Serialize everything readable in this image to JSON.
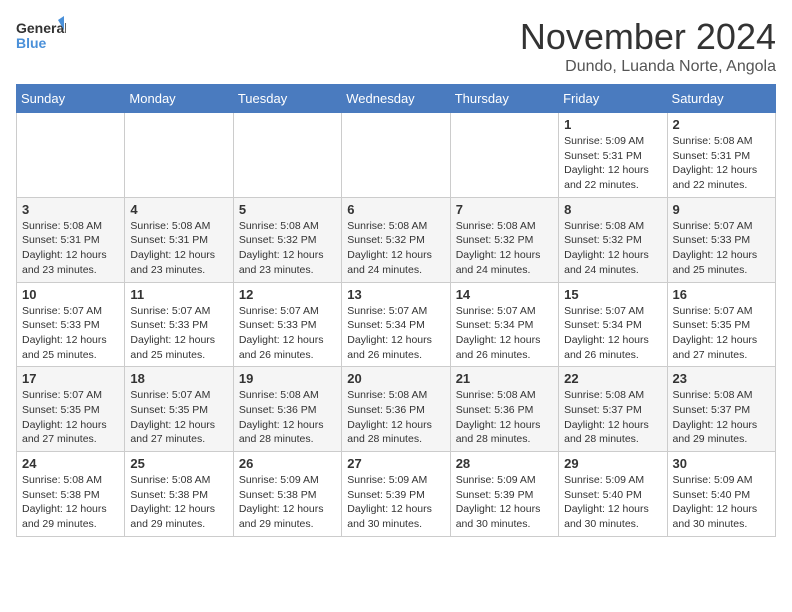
{
  "header": {
    "logo_general": "General",
    "logo_blue": "Blue",
    "month_title": "November 2024",
    "location": "Dundo, Luanda Norte, Angola"
  },
  "calendar": {
    "days_of_week": [
      "Sunday",
      "Monday",
      "Tuesday",
      "Wednesday",
      "Thursday",
      "Friday",
      "Saturday"
    ],
    "weeks": [
      [
        {
          "day": "",
          "info": ""
        },
        {
          "day": "",
          "info": ""
        },
        {
          "day": "",
          "info": ""
        },
        {
          "day": "",
          "info": ""
        },
        {
          "day": "",
          "info": ""
        },
        {
          "day": "1",
          "info": "Sunrise: 5:09 AM\nSunset: 5:31 PM\nDaylight: 12 hours\nand 22 minutes."
        },
        {
          "day": "2",
          "info": "Sunrise: 5:08 AM\nSunset: 5:31 PM\nDaylight: 12 hours\nand 22 minutes."
        }
      ],
      [
        {
          "day": "3",
          "info": "Sunrise: 5:08 AM\nSunset: 5:31 PM\nDaylight: 12 hours\nand 23 minutes."
        },
        {
          "day": "4",
          "info": "Sunrise: 5:08 AM\nSunset: 5:31 PM\nDaylight: 12 hours\nand 23 minutes."
        },
        {
          "day": "5",
          "info": "Sunrise: 5:08 AM\nSunset: 5:32 PM\nDaylight: 12 hours\nand 23 minutes."
        },
        {
          "day": "6",
          "info": "Sunrise: 5:08 AM\nSunset: 5:32 PM\nDaylight: 12 hours\nand 24 minutes."
        },
        {
          "day": "7",
          "info": "Sunrise: 5:08 AM\nSunset: 5:32 PM\nDaylight: 12 hours\nand 24 minutes."
        },
        {
          "day": "8",
          "info": "Sunrise: 5:08 AM\nSunset: 5:32 PM\nDaylight: 12 hours\nand 24 minutes."
        },
        {
          "day": "9",
          "info": "Sunrise: 5:07 AM\nSunset: 5:33 PM\nDaylight: 12 hours\nand 25 minutes."
        }
      ],
      [
        {
          "day": "10",
          "info": "Sunrise: 5:07 AM\nSunset: 5:33 PM\nDaylight: 12 hours\nand 25 minutes."
        },
        {
          "day": "11",
          "info": "Sunrise: 5:07 AM\nSunset: 5:33 PM\nDaylight: 12 hours\nand 25 minutes."
        },
        {
          "day": "12",
          "info": "Sunrise: 5:07 AM\nSunset: 5:33 PM\nDaylight: 12 hours\nand 26 minutes."
        },
        {
          "day": "13",
          "info": "Sunrise: 5:07 AM\nSunset: 5:34 PM\nDaylight: 12 hours\nand 26 minutes."
        },
        {
          "day": "14",
          "info": "Sunrise: 5:07 AM\nSunset: 5:34 PM\nDaylight: 12 hours\nand 26 minutes."
        },
        {
          "day": "15",
          "info": "Sunrise: 5:07 AM\nSunset: 5:34 PM\nDaylight: 12 hours\nand 26 minutes."
        },
        {
          "day": "16",
          "info": "Sunrise: 5:07 AM\nSunset: 5:35 PM\nDaylight: 12 hours\nand 27 minutes."
        }
      ],
      [
        {
          "day": "17",
          "info": "Sunrise: 5:07 AM\nSunset: 5:35 PM\nDaylight: 12 hours\nand 27 minutes."
        },
        {
          "day": "18",
          "info": "Sunrise: 5:07 AM\nSunset: 5:35 PM\nDaylight: 12 hours\nand 27 minutes."
        },
        {
          "day": "19",
          "info": "Sunrise: 5:08 AM\nSunset: 5:36 PM\nDaylight: 12 hours\nand 28 minutes."
        },
        {
          "day": "20",
          "info": "Sunrise: 5:08 AM\nSunset: 5:36 PM\nDaylight: 12 hours\nand 28 minutes."
        },
        {
          "day": "21",
          "info": "Sunrise: 5:08 AM\nSunset: 5:36 PM\nDaylight: 12 hours\nand 28 minutes."
        },
        {
          "day": "22",
          "info": "Sunrise: 5:08 AM\nSunset: 5:37 PM\nDaylight: 12 hours\nand 28 minutes."
        },
        {
          "day": "23",
          "info": "Sunrise: 5:08 AM\nSunset: 5:37 PM\nDaylight: 12 hours\nand 29 minutes."
        }
      ],
      [
        {
          "day": "24",
          "info": "Sunrise: 5:08 AM\nSunset: 5:38 PM\nDaylight: 12 hours\nand 29 minutes."
        },
        {
          "day": "25",
          "info": "Sunrise: 5:08 AM\nSunset: 5:38 PM\nDaylight: 12 hours\nand 29 minutes."
        },
        {
          "day": "26",
          "info": "Sunrise: 5:09 AM\nSunset: 5:38 PM\nDaylight: 12 hours\nand 29 minutes."
        },
        {
          "day": "27",
          "info": "Sunrise: 5:09 AM\nSunset: 5:39 PM\nDaylight: 12 hours\nand 30 minutes."
        },
        {
          "day": "28",
          "info": "Sunrise: 5:09 AM\nSunset: 5:39 PM\nDaylight: 12 hours\nand 30 minutes."
        },
        {
          "day": "29",
          "info": "Sunrise: 5:09 AM\nSunset: 5:40 PM\nDaylight: 12 hours\nand 30 minutes."
        },
        {
          "day": "30",
          "info": "Sunrise: 5:09 AM\nSunset: 5:40 PM\nDaylight: 12 hours\nand 30 minutes."
        }
      ]
    ]
  }
}
